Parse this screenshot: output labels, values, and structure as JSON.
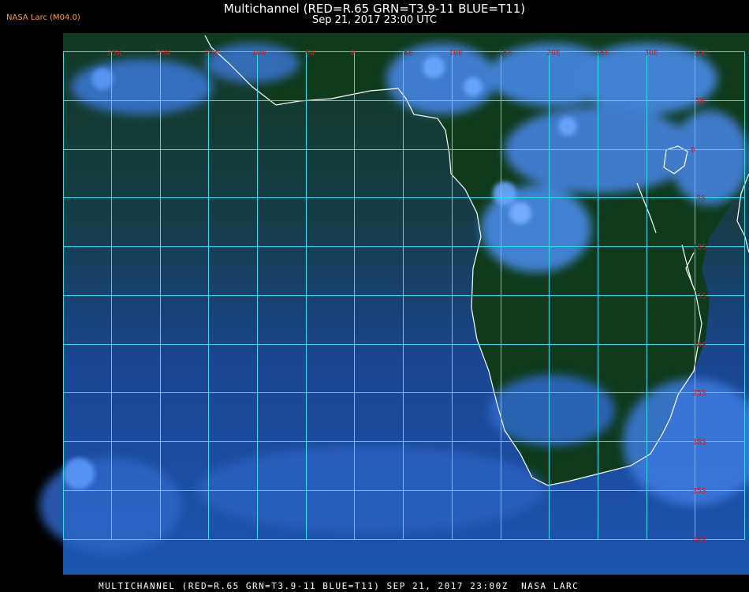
{
  "header": {
    "title": "Multichannel (RED=R.65 GRN=T3.9-11 BLUE=T11)",
    "subtitle": "Sep 21, 2017 23:00 UTC",
    "source": "NASA Larc (M04.0)"
  },
  "footer": {
    "text": "MULTICHANNEL (RED=R.65 GRN=T3.9-11 BLUE=T11) SEP 21, 2017 23:00Z  NASA LARC"
  },
  "map": {
    "region": "Southeast Atlantic / Southern Africa",
    "longitude_labels": [
      "25W",
      "20W",
      "15W",
      "10W",
      "5W",
      "0",
      "5E",
      "10E",
      "15E",
      "20E",
      "25E",
      "30E",
      "35E"
    ],
    "latitude_labels": [
      "5N",
      "0",
      "5S",
      "10S",
      "15S",
      "20S",
      "25S",
      "30S",
      "35S",
      "40S"
    ],
    "colors": {
      "grid": "#30e0e8",
      "grid_label": "#c81e1e",
      "coastline": "#ffffff",
      "ocean_clear": "#1a4a9a",
      "land_dark": "#0f3a1c",
      "cloud": "#4a8cf0"
    }
  }
}
